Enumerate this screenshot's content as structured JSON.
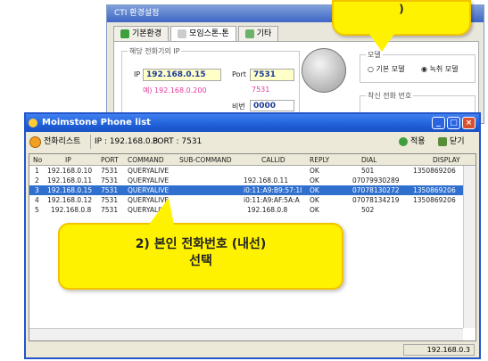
{
  "cti": {
    "title": "CTI 환경설정",
    "tabs": [
      "기본환경",
      "모임스톤-톤",
      "기타"
    ],
    "group_label": "해당 전화기의 IP",
    "ip_label": "IP",
    "ip_value": "192.168.0.15",
    "port_label": "Port",
    "port_value": "7531",
    "example_ip": "예) 192.168.0.200",
    "example_port": "7531",
    "password_label": "비번",
    "password_value": "0000",
    "mode_label": "모델",
    "mode_options": [
      "기본 모델",
      "녹취 모델"
    ],
    "incoming_label": "착신 전화 번호"
  },
  "bubble1_text": ")",
  "window": {
    "title": "Moimstone Phone list",
    "toolbar": {
      "list_button": "전화리스트",
      "ip_text": "IP : 192.168.0.3",
      "port_text": "PORT : 7531",
      "apply_button": "적용",
      "close_button": "닫기"
    },
    "columns": [
      "No",
      "IP",
      "PORT",
      "COMMAND",
      "SUB-COMMAND",
      "CALLID",
      "REPLY",
      "DIAL",
      "DISPLAY"
    ],
    "rows": [
      [
        "1",
        "192.168.0.10",
        "7531",
        "QUERYALIVE",
        "",
        "",
        "OK",
        "501",
        "1350869206"
      ],
      [
        "2",
        "192.168.0.11",
        "7531",
        "QUERYALIVE",
        "",
        "192.168.0.11",
        "OK",
        "07079930289",
        ""
      ],
      [
        "3",
        "192.168.0.15",
        "7531",
        "QUERYALIVE",
        "",
        "i0:11:A9:B9:57:1I",
        "OK",
        "07078130272",
        "1350869206"
      ],
      [
        "4",
        "192.168.0.12",
        "7531",
        "QUERYALIVE",
        "",
        "i0:11:A9:AF:5A:A",
        "OK",
        "07078134219",
        "1350869206"
      ],
      [
        "5",
        "192.168.0.8",
        "7531",
        "QUERYALIVE",
        "",
        "192.168.0.8",
        "OK",
        "502",
        ""
      ]
    ],
    "status_ip": "192.168.0.3"
  },
  "bubble2": {
    "line1": "2) 본인 전화번호 (내선)",
    "line2": "선택"
  },
  "colors": {
    "title_blue": "#2455c9",
    "selection": "#2f6fce",
    "bubble": "#fff200",
    "ip_highlight": "#ffffc8"
  }
}
